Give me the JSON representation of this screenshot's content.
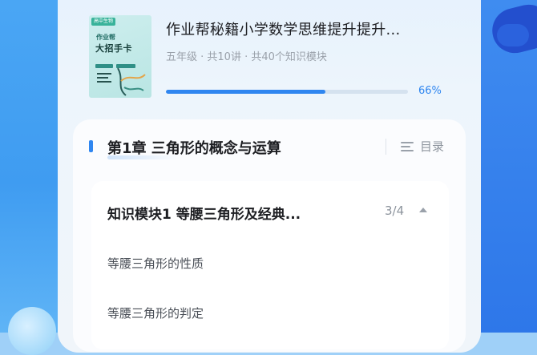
{
  "book": {
    "cover_tag": "高中生物",
    "cover_line1": "作业帮",
    "cover_line2": "大招手卡",
    "title": "作业帮秘籍小学数学思维提升提升...",
    "meta": "五年级 · 共10讲 · 共40个知识模块",
    "progress_percent": 66,
    "progress_label": "66%"
  },
  "chapter": {
    "title": "第1章  三角形的概念与运算",
    "toc_label": "目录"
  },
  "module": {
    "title": "知识模块1  等腰三角形及经典...",
    "count": "3/4",
    "lessons": [
      "等腰三角形的性质",
      "等腰三角形的判定"
    ]
  },
  "colors": {
    "accent": "#2f86f0",
    "title_text": "#1d1e22",
    "secondary_text": "#9aa1aa"
  }
}
